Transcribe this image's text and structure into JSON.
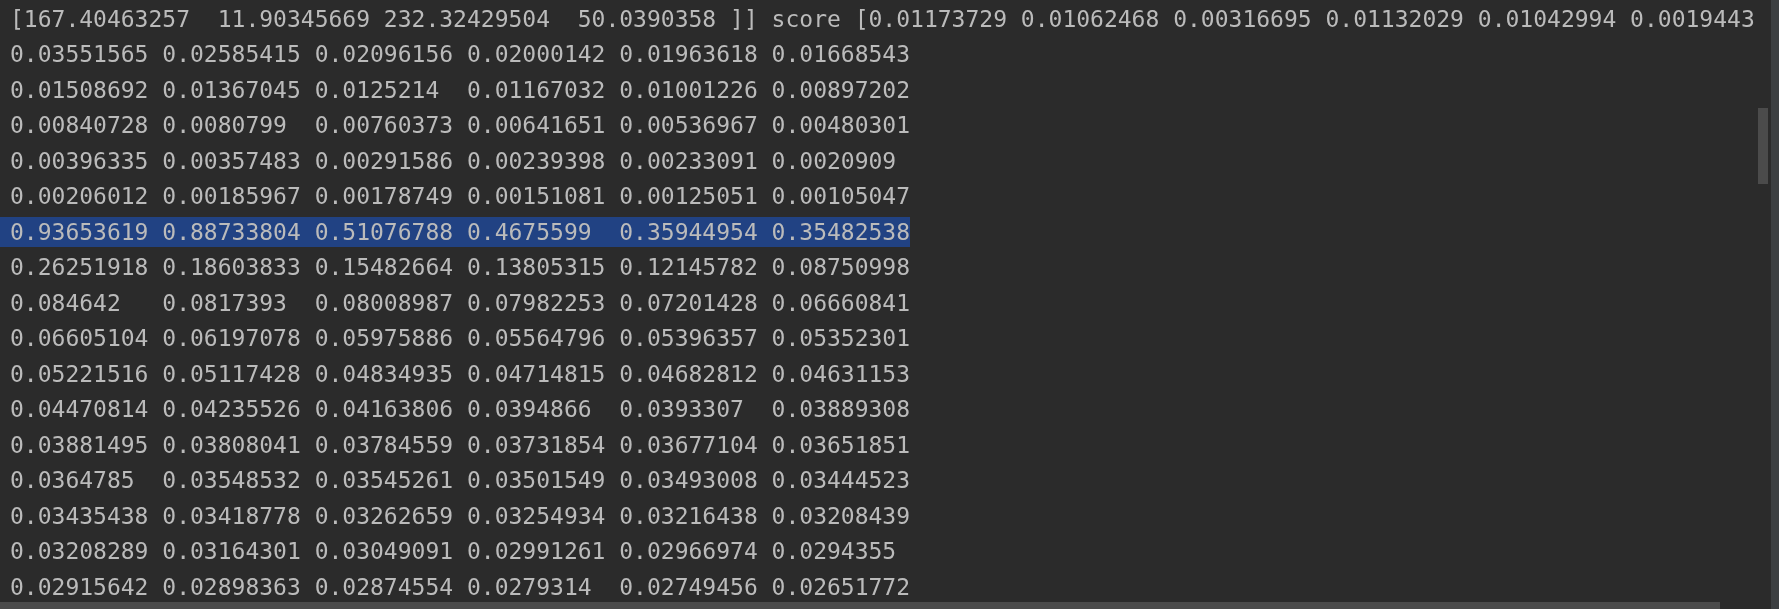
{
  "console": {
    "lines": [
      {
        "text": "[167.40463257  11.90345669 232.32429504  50.0390358 ]] score [0.01173729 0.01062468 0.00316695 0.01132029 0.01042994 0.0019443",
        "selected": false
      },
      {
        "text": "0.03551565 0.02585415 0.02096156 0.02000142 0.01963618 0.01668543",
        "selected": false
      },
      {
        "text": "0.01508692 0.01367045 0.0125214  0.01167032 0.01001226 0.00897202",
        "selected": false
      },
      {
        "text": "0.00840728 0.0080799  0.00760373 0.00641651 0.00536967 0.00480301",
        "selected": false
      },
      {
        "text": "0.00396335 0.00357483 0.00291586 0.00239398 0.00233091 0.0020909",
        "selected": false
      },
      {
        "text": "0.00206012 0.00185967 0.00178749 0.00151081 0.00125051 0.00105047",
        "selected": false
      },
      {
        "text": "0.93653619 0.88733804 0.51076788 0.4675599  0.35944954 0.35482538",
        "selected": true
      },
      {
        "text": "0.26251918 0.18603833 0.15482664 0.13805315 0.12145782 0.08750998",
        "selected": false
      },
      {
        "text": "0.084642   0.0817393  0.08008987 0.07982253 0.07201428 0.06660841",
        "selected": false
      },
      {
        "text": "0.06605104 0.06197078 0.05975886 0.05564796 0.05396357 0.05352301",
        "selected": false
      },
      {
        "text": "0.05221516 0.05117428 0.04834935 0.04714815 0.04682812 0.04631153",
        "selected": false
      },
      {
        "text": "0.04470814 0.04235526 0.04163806 0.0394866  0.0393307  0.03889308",
        "selected": false
      },
      {
        "text": "0.03881495 0.03808041 0.03784559 0.03731854 0.03677104 0.03651851",
        "selected": false
      },
      {
        "text": "0.0364785  0.03548532 0.03545261 0.03501549 0.03493008 0.03444523",
        "selected": false
      },
      {
        "text": "0.03435438 0.03418778 0.03262659 0.03254934 0.03216438 0.03208439",
        "selected": false
      },
      {
        "text": "0.03208289 0.03164301 0.03049091 0.02991261 0.02966974 0.0294355",
        "selected": false
      },
      {
        "text": "0.02915642 0.02898363 0.02874554 0.0279314  0.02749456 0.02651772",
        "selected": false
      }
    ]
  }
}
